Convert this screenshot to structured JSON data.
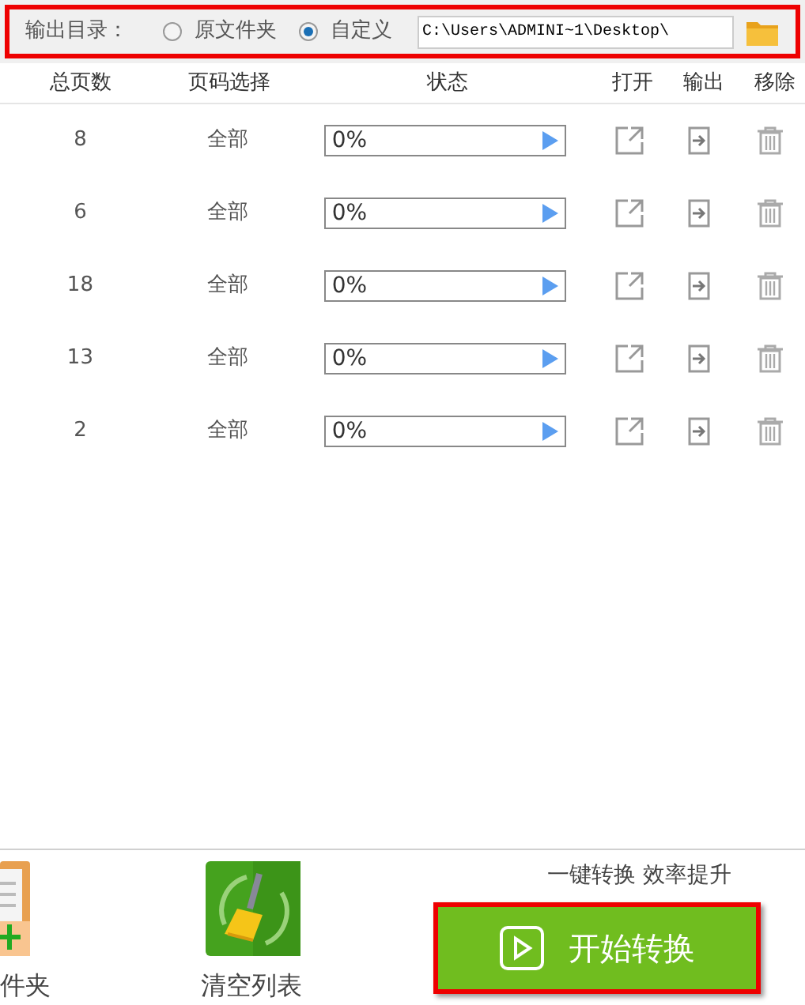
{
  "output_dir": {
    "label": "输出目录：",
    "options": [
      {
        "label": "原文件夹",
        "selected": false
      },
      {
        "label": "自定义",
        "selected": true
      }
    ],
    "path": "C:\\Users\\ADMINI~1\\Desktop\\"
  },
  "table": {
    "columns": [
      "总页数",
      "页码选择",
      "状态",
      "打开",
      "输出",
      "移除"
    ],
    "rows": [
      {
        "pages": "8",
        "range": "全部",
        "progress": "0%",
        "level": 0
      },
      {
        "pages": "6",
        "range": "全部",
        "progress": "0%",
        "level": 0
      },
      {
        "pages": "18",
        "range": "全部",
        "progress": "0%",
        "level": 0
      },
      {
        "pages": "13",
        "range": "全部",
        "progress": "0%",
        "level": 0
      },
      {
        "pages": "2",
        "range": "全部",
        "progress": "0%",
        "level": 0
      }
    ]
  },
  "bottom": {
    "add_folder_label": "件夹",
    "clear_label": "清空列表",
    "slogan": "一键转换 效率提升",
    "start_button": "开始转换"
  }
}
